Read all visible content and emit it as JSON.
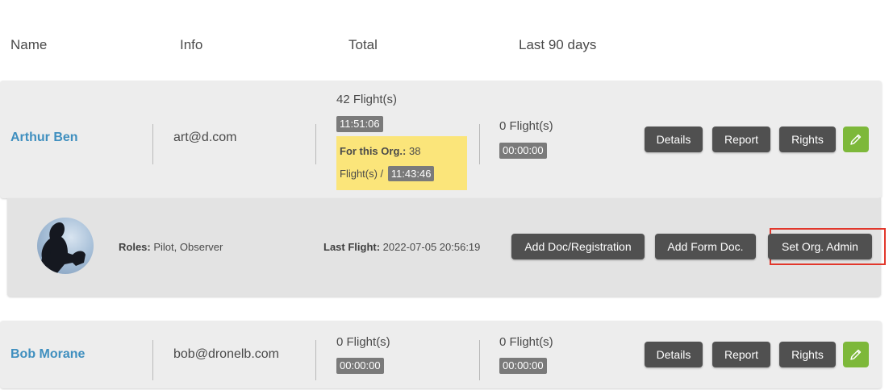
{
  "header": {
    "name": "Name",
    "info": "Info",
    "total": "Total",
    "last90": "Last 90 days"
  },
  "pilots": [
    {
      "name": "Arthur Ben",
      "email": "art@d.com",
      "total_flights": "42 Flight(s)",
      "total_time": "11:51:06",
      "org_label": "For this Org.:",
      "org_count": "38",
      "org_flights_suffix": "Flight(s) /",
      "org_time": "11:43:46",
      "last90_flights": "0 Flight(s)",
      "last90_time": "00:00:00"
    },
    {
      "name": "Bob Morane",
      "email": "bob@dronelb.com",
      "total_flights": "0 Flight(s)",
      "total_time": "00:00:00",
      "last90_flights": "0 Flight(s)",
      "last90_time": "00:00:00"
    }
  ],
  "actions": {
    "details": "Details",
    "report": "Report",
    "rights": "Rights"
  },
  "detail": {
    "roles_label": "Roles:",
    "roles_value": "Pilot, Observer",
    "last_flight_label": "Last Flight:",
    "last_flight_value": "2022-07-05 20:56:19",
    "add_doc": "Add Doc/Registration",
    "add_form": "Add Form Doc.",
    "set_admin": "Set Org. Admin"
  },
  "colors": {
    "accent_link": "#3f8fbf",
    "button_dark": "#505050",
    "edit_green": "#7db83a",
    "org_highlight": "#fbe57a",
    "annotation_red": "#e2372b"
  },
  "icons": {
    "edit": "pencil-icon"
  }
}
